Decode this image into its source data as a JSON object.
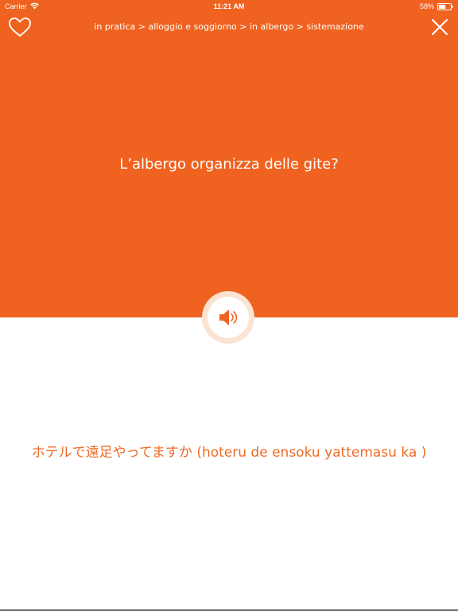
{
  "status_bar": {
    "carrier": "Carrier",
    "time": "11:21 AM",
    "battery": "58%",
    "battery_level": 0.58
  },
  "header": {
    "breadcrumb": "in pratica > alloggio e soggiorno > in albergo > sistemazione",
    "favorite_icon": "heart-outline-icon",
    "close_icon": "close-icon"
  },
  "card": {
    "phrase": "L’albergo organizza delle gite?",
    "translation": "ホテルで遠足やってますか (hoteru de ensoku yattemasu ka )",
    "audio_icon": "speaker-icon"
  },
  "colors": {
    "accent": "#f0621f",
    "translation_text": "#ee6a24",
    "audio_ring": "#fbe3d3"
  }
}
